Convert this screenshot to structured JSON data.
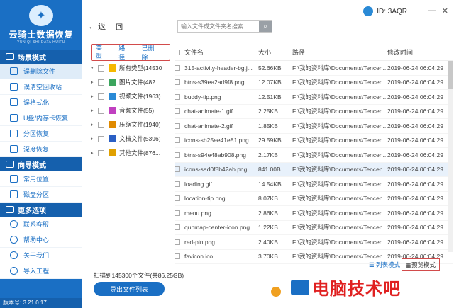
{
  "app": {
    "title": "云骑士数据恢复",
    "subtitle": "YUN QI SHI DATA HUIFU",
    "version": "版本号: 3.21.0.17",
    "user_id": "ID: 3AQR"
  },
  "sidebar": {
    "sections": [
      {
        "title": "场景模式",
        "items": [
          {
            "label": "误删除文件",
            "active": true
          },
          {
            "label": "误清空回收站"
          },
          {
            "label": "误格式化"
          },
          {
            "label": "U盘/内存卡恢复"
          },
          {
            "label": "分区恢复"
          },
          {
            "label": "深度恢复"
          }
        ]
      },
      {
        "title": "向导模式",
        "items": [
          {
            "label": "常用位置"
          },
          {
            "label": "磁盘分区"
          }
        ]
      },
      {
        "title": "更多选项",
        "items": [
          {
            "label": "联系客服"
          },
          {
            "label": "帮助中心"
          },
          {
            "label": "关于我们"
          },
          {
            "label": "导入工程"
          }
        ]
      }
    ]
  },
  "toolbar": {
    "back_label": "返",
    "return_label": "回",
    "search_placeholder": "输入文件或文件夹名搜索"
  },
  "tabs": [
    "类型",
    "路径",
    "已删除"
  ],
  "tree": [
    {
      "label": "所有类型(14530",
      "color": "#f5b800",
      "expand": "▾"
    },
    {
      "label": "图片文件(482...",
      "color": "#3ba55d",
      "expand": "▸"
    },
    {
      "label": "视频文件(1963)",
      "color": "#2a8ad6",
      "expand": "▸"
    },
    {
      "label": "音频文件(55)",
      "color": "#c040c0",
      "expand": "▸"
    },
    {
      "label": "压缩文件(1940)",
      "color": "#e08a00",
      "expand": "▸"
    },
    {
      "label": "文档文件(5396)",
      "color": "#2a5fc4",
      "expand": "▸"
    },
    {
      "label": "其他文件(876...",
      "color": "#e0a000",
      "expand": "▸"
    }
  ],
  "table": {
    "headers": [
      "文件名",
      "大小",
      "路径",
      "修改时间"
    ],
    "rows": [
      {
        "name": "315-activity-header-bg.j...",
        "size": "52.66KB",
        "path": "F:\\我的资料库\\Documents\\Tencen...",
        "time": "2019-06-24 06:04:29"
      },
      {
        "name": "btns-s39ea2ad9f8.png",
        "size": "12.07KB",
        "path": "F:\\我的资料库\\Documents\\Tencen...",
        "time": "2019-06-24 06:04:29"
      },
      {
        "name": "buddy-tip.png",
        "size": "12.51KB",
        "path": "F:\\我的资料库\\Documents\\Tencen...",
        "time": "2019-06-24 06:04:29"
      },
      {
        "name": "chat-animate-1.gif",
        "size": "2.25KB",
        "path": "F:\\我的资料库\\Documents\\Tencen...",
        "time": "2019-06-24 06:04:29"
      },
      {
        "name": "chat-animate-2.gif",
        "size": "1.85KB",
        "path": "F:\\我的资料库\\Documents\\Tencen...",
        "time": "2019-06-24 06:04:29"
      },
      {
        "name": "icons-sb25ee41e81.png",
        "size": "29.59KB",
        "path": "F:\\我的资料库\\Documents\\Tencen...",
        "time": "2019-06-24 06:04:29"
      },
      {
        "name": "btns-s94e48ab908.png",
        "size": "2.17KB",
        "path": "F:\\我的资料库\\Documents\\Tencen...",
        "time": "2019-06-24 06:04:29"
      },
      {
        "name": "icons-sad0f8b42ab.png",
        "size": "841.00B",
        "path": "F:\\我的资料库\\Documents\\Tencen...",
        "time": "2019-06-24 06:04:29",
        "selected": true
      },
      {
        "name": "loading.gif",
        "size": "14.54KB",
        "path": "F:\\我的资料库\\Documents\\Tencen...",
        "time": "2019-06-24 06:04:29"
      },
      {
        "name": "location-tip.png",
        "size": "8.07KB",
        "path": "F:\\我的资料库\\Documents\\Tencen...",
        "time": "2019-06-24 06:04:29"
      },
      {
        "name": "menu.png",
        "size": "2.86KB",
        "path": "F:\\我的资料库\\Documents\\Tencen...",
        "time": "2019-06-24 06:04:29"
      },
      {
        "name": "qunmap-center-icon.png",
        "size": "1.22KB",
        "path": "F:\\我的资料库\\Documents\\Tencen...",
        "time": "2019-06-24 06:04:29"
      },
      {
        "name": "red-pin.png",
        "size": "2.40KB",
        "path": "F:\\我的资料库\\Documents\\Tencen...",
        "time": "2019-06-24 06:04:29"
      },
      {
        "name": "favicon.ico",
        "size": "3.70KB",
        "path": "F:\\我的资料库\\Documents\\Tencen...",
        "time": "2019-06-24 06:04:29"
      }
    ]
  },
  "bottom": {
    "scan_info": "扫描到145300个文件(共86.25GB)",
    "export_label": "导出文件列表",
    "view_list": "列表模式",
    "view_preview": "预览模式"
  },
  "watermark": {
    "text": "电脑技术吧"
  }
}
